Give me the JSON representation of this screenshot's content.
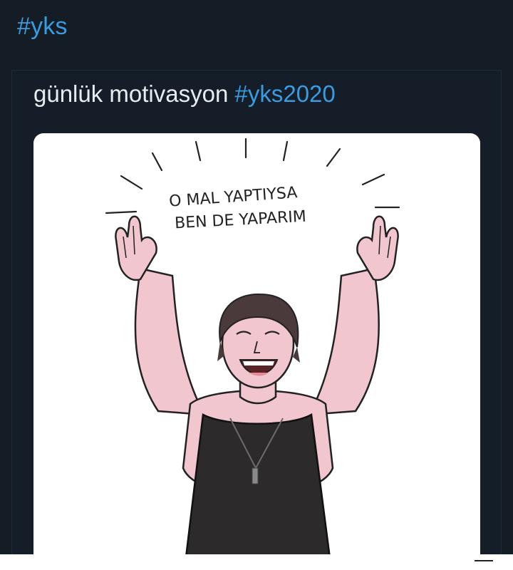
{
  "header": {
    "hashtag": "#yks"
  },
  "tweet": {
    "text": "günlük motivasyon",
    "hashtag": "#yks2020"
  },
  "image": {
    "caption_line1": "O MAL YAPTIYSA",
    "caption_line2": "BEN DE YAPARIM"
  },
  "colors": {
    "background": "#141d26",
    "link": "#3a9be0",
    "text": "#e6ecf0",
    "skin": "#f2c6cf",
    "hair": "#4a3a3c",
    "shirt": "#2c2a2b"
  }
}
